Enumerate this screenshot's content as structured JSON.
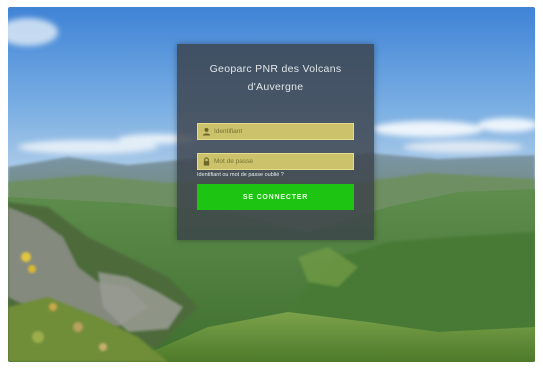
{
  "login": {
    "title_line1": "Geoparc PNR des Volcans",
    "title_line2": "d'Auvergne",
    "username_placeholder": "Identifiant",
    "password_placeholder": "Mot de passe",
    "forgot_label": "Identifiant ou mot de passe oublié ?",
    "submit_label": "SE CONNECTER"
  },
  "colors": {
    "panel_bg": "#3c424a",
    "field_bg": "#cbc26b",
    "button_bg": "#1ec412"
  },
  "icons": {
    "username": "user-icon",
    "password": "lock-icon"
  }
}
